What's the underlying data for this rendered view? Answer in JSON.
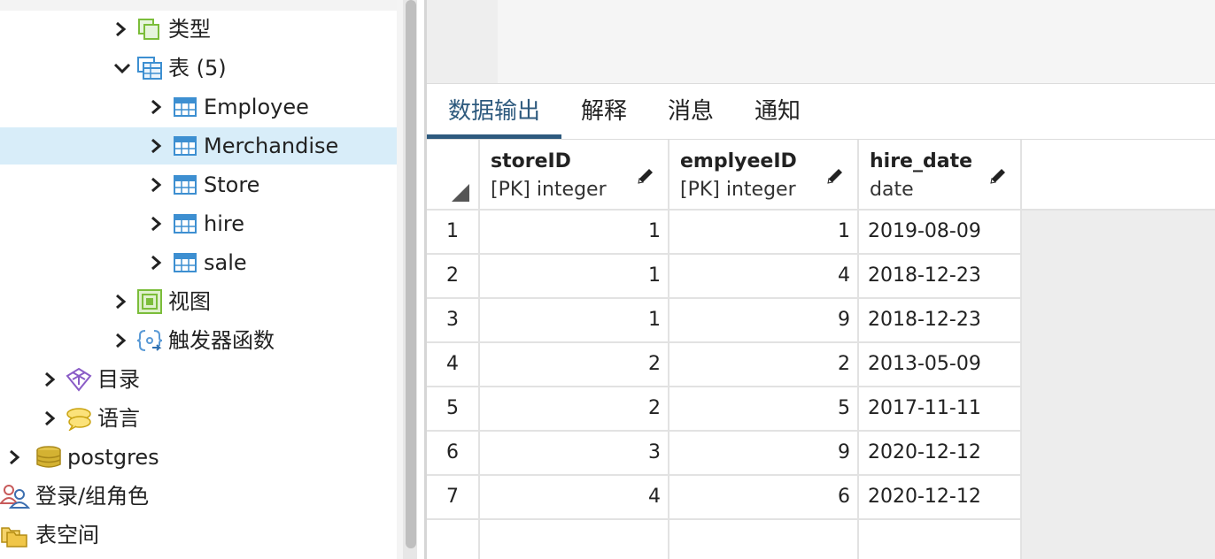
{
  "tree": {
    "items": [
      {
        "label": "类型",
        "icon": "types-icon"
      },
      {
        "label": "表 (5)",
        "icon": "tables-folder-icon",
        "expanded": true
      },
      {
        "label": "Employee",
        "icon": "table-icon"
      },
      {
        "label": "Merchandise",
        "icon": "table-icon",
        "selected": true
      },
      {
        "label": "Store",
        "icon": "table-icon"
      },
      {
        "label": "hire",
        "icon": "table-icon"
      },
      {
        "label": "sale",
        "icon": "table-icon"
      },
      {
        "label": "视图",
        "icon": "views-icon"
      },
      {
        "label": "触发器函数",
        "icon": "trigger-function-icon"
      },
      {
        "label": "目录",
        "icon": "catalog-icon"
      },
      {
        "label": "语言",
        "icon": "language-icon"
      },
      {
        "label": "postgres",
        "icon": "database-icon"
      },
      {
        "label": "登录/组角色",
        "icon": "login-roles-icon"
      },
      {
        "label": "表空间",
        "icon": "tablespace-icon"
      }
    ]
  },
  "tabs": [
    {
      "label": "数据输出",
      "active": true
    },
    {
      "label": "解释"
    },
    {
      "label": "消息"
    },
    {
      "label": "通知"
    }
  ],
  "grid": {
    "columns": [
      {
        "name": "storeID",
        "type": "[PK] integer"
      },
      {
        "name": "emplyeeID",
        "type": "[PK] integer"
      },
      {
        "name": "hire_date",
        "type": "date"
      }
    ],
    "rows": [
      {
        "n": "1",
        "storeID": "1",
        "emplyeeID": "1",
        "hire_date": "2019-08-09"
      },
      {
        "n": "2",
        "storeID": "1",
        "emplyeeID": "4",
        "hire_date": "2018-12-23"
      },
      {
        "n": "3",
        "storeID": "1",
        "emplyeeID": "9",
        "hire_date": "2018-12-23"
      },
      {
        "n": "4",
        "storeID": "2",
        "emplyeeID": "2",
        "hire_date": "2013-05-09"
      },
      {
        "n": "5",
        "storeID": "2",
        "emplyeeID": "5",
        "hire_date": "2017-11-11"
      },
      {
        "n": "6",
        "storeID": "3",
        "emplyeeID": "9",
        "hire_date": "2020-12-12"
      },
      {
        "n": "7",
        "storeID": "4",
        "emplyeeID": "6",
        "hire_date": "2020-12-12"
      }
    ]
  },
  "colors": {
    "accent": "#2e5a7e",
    "selected_row": "#d8edf9",
    "table_icon": "#3d8fd1",
    "views_icon": "#7bbd3a"
  }
}
